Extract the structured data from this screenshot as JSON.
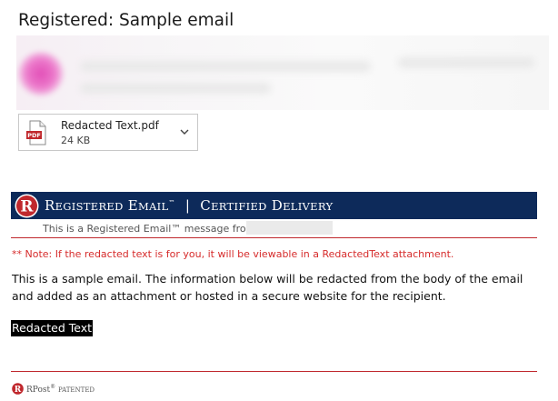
{
  "email": {
    "subject": "Registered: Sample email"
  },
  "attachment": {
    "icon": "pdf-file-icon",
    "file_type_label": "PDF",
    "filename": "Redacted Text.pdf",
    "size": "24 KB",
    "menu_icon": "chevron-down-icon"
  },
  "banner": {
    "logo_letter": "R",
    "title_part1_initial": "R",
    "title_part1_rest": "egistered",
    "title_part2_initial": "E",
    "title_part2_rest": "mail",
    "trademark": "™",
    "separator": "|",
    "title_part3_initial": "C",
    "title_part3_rest": "ertified",
    "title_part4_initial": "D",
    "title_part4_rest": "elivery",
    "subtitle": "This is a Registered Email™ message from",
    "bg_color": "#0d2a5a",
    "logo_color": "#c0282d"
  },
  "body": {
    "note": "** Note: If the redacted text is for you, it will be viewable in a RedactedText attachment.",
    "paragraph": "This is a sample email. The information below will be redacted from the body of the email and added as an attachment or hosted in a secure website for the recipient.",
    "redacted_label": "Redacted Text"
  },
  "footer": {
    "logo_letter": "R",
    "brand": "RPost",
    "registered": "®",
    "patented": "Patented"
  },
  "colors": {
    "accent_red": "#c0282d",
    "note_red": "#d62b2b"
  }
}
